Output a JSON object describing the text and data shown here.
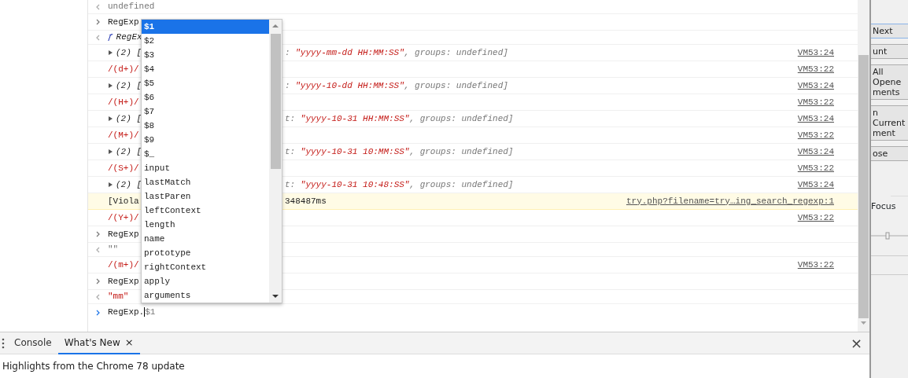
{
  "console": {
    "rows": [
      {
        "kind": "result",
        "text": "undefined"
      },
      {
        "kind": "input",
        "text": "RegExp"
      },
      {
        "kind": "function",
        "glyph": "ƒ",
        "text": "RegEx"
      },
      {
        "kind": "array",
        "text": "(2) [",
        "right": [
          ": ",
          "\"yyyy-mm-dd HH:MM:SS\"",
          ", groups: undefined]"
        ],
        "source": "VM53:24"
      },
      {
        "kind": "regex",
        "text": "/(d+)/",
        "source": "VM53:22"
      },
      {
        "kind": "array",
        "text": "(2) [",
        "right": [
          ": ",
          "\"yyyy-10-dd HH:MM:SS\"",
          ", groups: undefined]"
        ],
        "source": "VM53:24"
      },
      {
        "kind": "regex",
        "text": "/(H+)/",
        "source": "VM53:22"
      },
      {
        "kind": "array",
        "text": "(2) [",
        "right": [
          "t: ",
          "\"yyyy-10-31 HH:MM:SS\"",
          ", groups: undefined]"
        ],
        "source": "VM53:24"
      },
      {
        "kind": "regex",
        "text": "/(M+)/",
        "source": "VM53:22"
      },
      {
        "kind": "array",
        "text": "(2) [",
        "right": [
          "t: ",
          "\"yyyy-10-31 10:MM:SS\"",
          ", groups: undefined]"
        ],
        "source": "VM53:24"
      },
      {
        "kind": "regex",
        "text": "/(S+)/",
        "source": "VM53:22"
      },
      {
        "kind": "array",
        "text": "(2) [",
        "right": [
          "t: ",
          "\"yyyy-10-31 10:48:SS\"",
          ", groups: undefined]"
        ],
        "source": "VM53:24"
      },
      {
        "kind": "violation",
        "text": "[Viola",
        "right": [
          "348487ms"
        ],
        "source": "try.php?filename=try…ing_search_regexp:1"
      },
      {
        "kind": "regex",
        "text": "/(Y+)/",
        "source": "VM53:22"
      },
      {
        "kind": "input",
        "text": "RegExp"
      },
      {
        "kind": "result",
        "text": "\"\""
      },
      {
        "kind": "regex",
        "text": "/(m+)/",
        "source": "VM53:22"
      },
      {
        "kind": "input",
        "text": "RegExp"
      },
      {
        "kind": "string",
        "text": "\"mm\""
      }
    ],
    "prompt": {
      "value": "RegExp.",
      "suggestion": "$1"
    }
  },
  "autocomplete": {
    "items": [
      {
        "label": "$1",
        "selected": true
      },
      {
        "label": "$2",
        "selected": false
      },
      {
        "label": "$3",
        "selected": false
      },
      {
        "label": "$4",
        "selected": false
      },
      {
        "label": "$5",
        "selected": false
      },
      {
        "label": "$6",
        "selected": false
      },
      {
        "label": "$7",
        "selected": false
      },
      {
        "label": "$8",
        "selected": false
      },
      {
        "label": "$9",
        "selected": false
      },
      {
        "label": "$_",
        "selected": false
      },
      {
        "label": "input",
        "selected": false
      },
      {
        "label": "lastMatch",
        "selected": false
      },
      {
        "label": "lastParen",
        "selected": false
      },
      {
        "label": "leftContext",
        "selected": false
      },
      {
        "label": "length",
        "selected": false
      },
      {
        "label": "name",
        "selected": false
      },
      {
        "label": "prototype",
        "selected": false
      },
      {
        "label": "rightContext",
        "selected": false
      },
      {
        "label": "apply",
        "selected": false
      },
      {
        "label": "arguments",
        "selected": false
      }
    ]
  },
  "drawer": {
    "tabs": [
      {
        "label": "Console",
        "selected": false
      },
      {
        "label": "What's New",
        "selected": true,
        "close": "×"
      }
    ],
    "close": "×",
    "text": "Highlights from the Chrome 78 update"
  },
  "side_dialog": {
    "buttons": [
      [
        "Next"
      ],
      [
        "unt"
      ],
      [
        "All Opene",
        "ments"
      ],
      [
        "n Current",
        "ment"
      ],
      [
        "ose"
      ]
    ],
    "label": "Focus"
  }
}
